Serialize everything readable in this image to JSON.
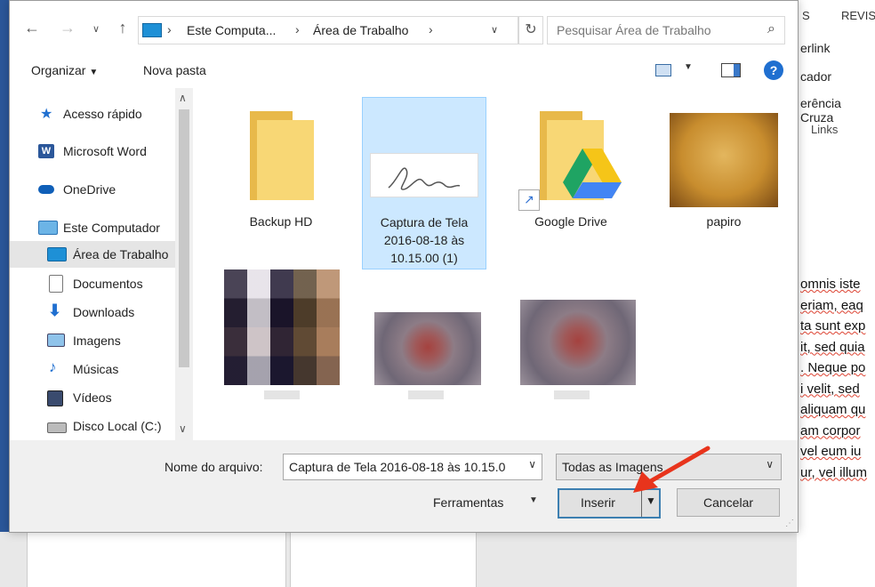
{
  "background": {
    "ribbon_tabs": [
      "S",
      "REVIS"
    ],
    "ribbon_items": [
      "erlink",
      "cador",
      "erência Cruza"
    ],
    "ribbon_group": "Links",
    "doc_lines": [
      "omnis iste",
      "eriam, eaq",
      "ta sunt exp",
      "it, sed quia",
      ". Neque po",
      "i velit, sed",
      "aliquam qu",
      "am corpor",
      "vel eum iu",
      "ur, vel illum"
    ]
  },
  "navbar": {
    "path": [
      "Este Computa...",
      "Área de Trabalho"
    ],
    "search_placeholder": "Pesquisar Área de Trabalho"
  },
  "toolbar": {
    "organize": "Organizar",
    "new_folder": "Nova pasta"
  },
  "sidebar": {
    "items": [
      {
        "label": "Acesso rápido",
        "icon": "star-icon"
      },
      {
        "label": "Microsoft Word",
        "icon": "word-icon"
      },
      {
        "label": "OneDrive",
        "icon": "cloud-icon"
      },
      {
        "label": "Este Computador",
        "icon": "computer-icon"
      },
      {
        "label": "Área de Trabalho",
        "icon": "desktop-icon",
        "selected": true
      },
      {
        "label": "Documentos",
        "icon": "document-icon"
      },
      {
        "label": "Downloads",
        "icon": "download-icon"
      },
      {
        "label": "Imagens",
        "icon": "pictures-icon"
      },
      {
        "label": "Músicas",
        "icon": "music-icon"
      },
      {
        "label": "Vídeos",
        "icon": "video-icon"
      },
      {
        "label": "Disco Local (C:)",
        "icon": "drive-icon"
      }
    ]
  },
  "files": [
    {
      "name": "Backup HD",
      "type": "folder"
    },
    {
      "name": "Captura de Tela 2016-08-18 às 10.15.00 (1)",
      "name_lines": [
        "Captura de Tela",
        "2016-08-18 às",
        "10.15.00 (1)"
      ],
      "type": "image",
      "selected": true
    },
    {
      "name": "Google Drive",
      "type": "folder-shortcut"
    },
    {
      "name": "papiro",
      "type": "image"
    }
  ],
  "footer": {
    "file_name_label": "Nome do arquivo:",
    "file_name_value": "Captura de Tela 2016-08-18 às 10.15.0",
    "file_type": "Todas as Imagens",
    "tools": "Ferramentas",
    "insert": "Inserir",
    "cancel": "Cancelar"
  },
  "colors": {
    "accent": "#1e90d6",
    "selection": "#cce8ff",
    "annotation_arrow": "#e8341c"
  }
}
